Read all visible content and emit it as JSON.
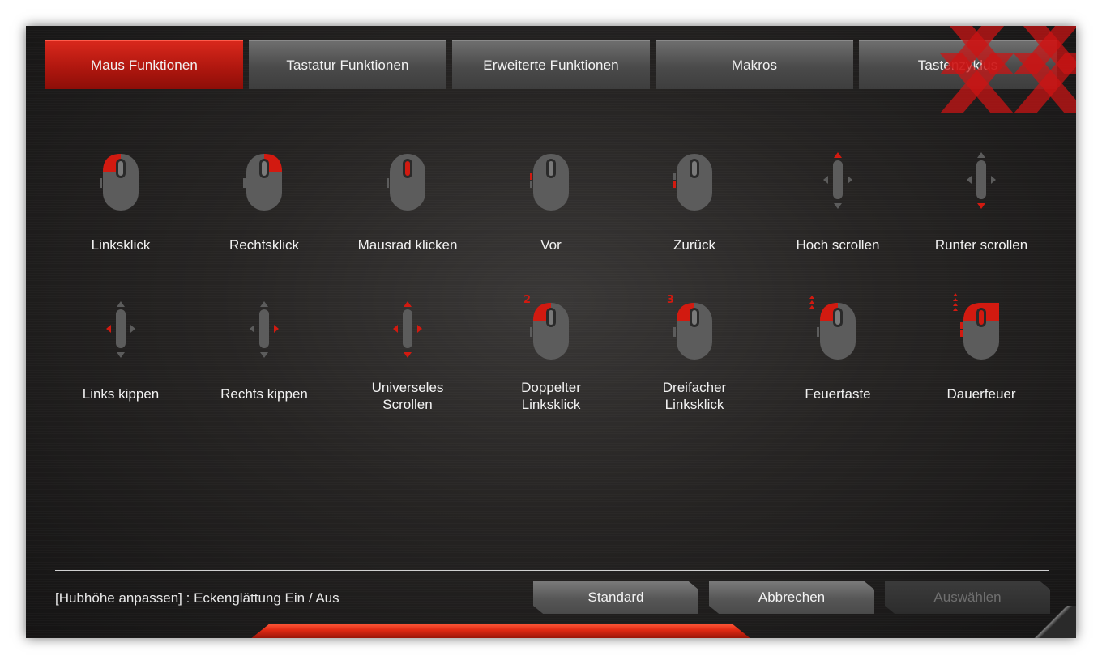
{
  "tabs": [
    {
      "label": "Maus Funktionen",
      "active": true
    },
    {
      "label": "Tastatur Funktionen",
      "active": false
    },
    {
      "label": "Erweiterte Funktionen",
      "active": false
    },
    {
      "label": "Makros",
      "active": false
    },
    {
      "label": "Tastenzyklus",
      "active": false
    }
  ],
  "functions_row1": [
    {
      "label": "Linksklick",
      "icon": "mouse-left-click-icon"
    },
    {
      "label": "Rechtsklick",
      "icon": "mouse-right-click-icon"
    },
    {
      "label": "Mausrad klicken",
      "icon": "mouse-wheel-click-icon"
    },
    {
      "label": "Vor",
      "icon": "mouse-forward-icon"
    },
    {
      "label": "Zurück",
      "icon": "mouse-back-icon"
    },
    {
      "label": "Hoch scrollen",
      "icon": "scroll-up-icon"
    },
    {
      "label": "Runter scrollen",
      "icon": "scroll-down-icon"
    }
  ],
  "functions_row2": [
    {
      "label": "Links kippen",
      "icon": "tilt-left-icon"
    },
    {
      "label": "Rechts kippen",
      "icon": "tilt-right-icon"
    },
    {
      "label": "Universeles\nScrollen",
      "icon": "universal-scroll-icon"
    },
    {
      "label": "Doppelter\nLinksklick",
      "icon": "double-left-click-icon",
      "badge": "2"
    },
    {
      "label": "Dreifacher\nLinksklick",
      "icon": "triple-left-click-icon",
      "badge": "3"
    },
    {
      "label": "Feuertaste",
      "icon": "fire-button-icon"
    },
    {
      "label": "Dauerfeuer",
      "icon": "rapid-fire-icon"
    }
  ],
  "footer": {
    "note": "[Hubhöhe anpassen] : Eckenglättung Ein / Aus",
    "standard": "Standard",
    "cancel": "Abbrechen",
    "select": "Auswählen"
  },
  "colors": {
    "accent": "#c8170d",
    "icon_gray": "#5c5c5c"
  }
}
